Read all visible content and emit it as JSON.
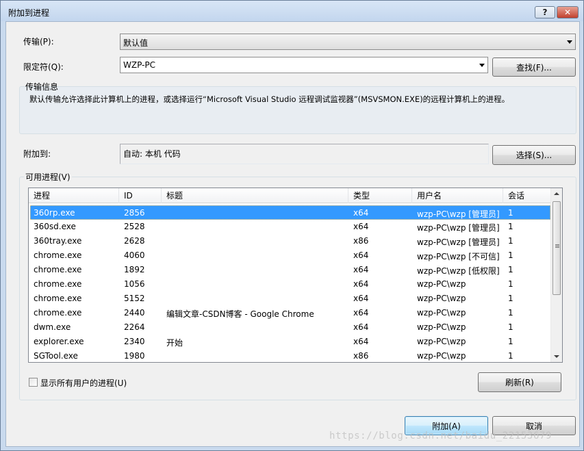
{
  "window": {
    "title": "附加到进程",
    "help_label": "?",
    "close_label": "✕"
  },
  "transport": {
    "label": "传输(P):",
    "value": "默认值"
  },
  "qualifier": {
    "label": "限定符(Q):",
    "value": "WZP-PC",
    "find_label": "查找(F)..."
  },
  "transport_info": {
    "title": "传输信息",
    "text": "默认传输允许选择此计算机上的进程，或选择运行“Microsoft Visual Studio 远程调试监视器”(MSVSMON.EXE)的远程计算机上的进程。"
  },
  "attach_to": {
    "label": "附加到:",
    "value": "自动: 本机 代码",
    "select_label": "选择(S)..."
  },
  "processes": {
    "title": "可用进程(V)",
    "columns": [
      "进程",
      "ID",
      "标题",
      "类型",
      "用户名",
      "会话"
    ],
    "rows": [
      [
        "360rp.exe",
        "2856",
        "",
        "x64",
        "wzp-PC\\wzp [管理员]",
        "1"
      ],
      [
        "360sd.exe",
        "2528",
        "",
        "x64",
        "wzp-PC\\wzp [管理员]",
        "1"
      ],
      [
        "360tray.exe",
        "2628",
        "",
        "x86",
        "wzp-PC\\wzp [管理员]",
        "1"
      ],
      [
        "chrome.exe",
        "4060",
        "",
        "x64",
        "wzp-PC\\wzp [不可信]",
        "1"
      ],
      [
        "chrome.exe",
        "1892",
        "",
        "x64",
        "wzp-PC\\wzp [低权限]",
        "1"
      ],
      [
        "chrome.exe",
        "1056",
        "",
        "x64",
        "wzp-PC\\wzp",
        "1"
      ],
      [
        "chrome.exe",
        "5152",
        "",
        "x64",
        "wzp-PC\\wzp",
        "1"
      ],
      [
        "chrome.exe",
        "2440",
        "编辑文章-CSDN博客 - Google Chrome",
        "x64",
        "wzp-PC\\wzp",
        "1"
      ],
      [
        "dwm.exe",
        "2264",
        "",
        "x64",
        "wzp-PC\\wzp",
        "1"
      ],
      [
        "explorer.exe",
        "2340",
        "开始",
        "x64",
        "wzp-PC\\wzp",
        "1"
      ],
      [
        "SGTool.exe",
        "1980",
        "",
        "x86",
        "wzp-PC\\wzp",
        "1"
      ]
    ],
    "selected_index": 0,
    "show_all_label": "显示所有用户的进程(U)",
    "refresh_label": "刷新(R)"
  },
  "footer": {
    "attach_label": "附加(A)",
    "cancel_label": "取消"
  },
  "watermark": "https://blog.csdn.net/baidu_22153679",
  "colors": {
    "selection": "#3399ff",
    "frame": "#c9daee",
    "close": "#c0402d"
  }
}
